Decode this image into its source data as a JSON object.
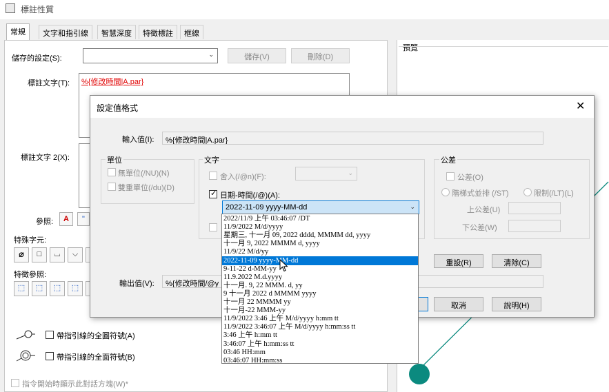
{
  "window": {
    "title": "標註性質"
  },
  "tabs": [
    "常規",
    "文字和指引線",
    "智慧深度",
    "特徵標註",
    "框線"
  ],
  "main": {
    "saved_label": "儲存的設定(S):",
    "save_btn": "儲存(V)",
    "delete_btn": "刪除(D)",
    "note_text_label": "標註文字(T):",
    "note_text_value": "%{修改時間|A.par}",
    "note_text2_label": "標註文字 2(X):",
    "ref_label": "參照:",
    "special_chars_label": "特殊字元:",
    "feature_ref_label": "特徵參照:",
    "leader_full_circle": "帶指引線的全圓符號(A)",
    "leader_full_surface": "帶指引線的全面符號(B)",
    "show_dialog_on_start": "指令開始時顯示此對話方塊(W)*",
    "preview_label": "預覽"
  },
  "dialog": {
    "title": "設定值格式",
    "input_label": "輸入值(I):",
    "input_value": "%{修改時間|A.par}",
    "unit_group": "單位",
    "no_unit": "無單位(/NU)(N)",
    "dual_unit": "雙重單位(/du)(D)",
    "text_group": "文字",
    "round_label": "舍入(/@n)(F):",
    "datetime_label": "日期-時間(/@)(A):",
    "datetime_selected": "2022-11-09     yyyy-MM-dd",
    "tolerance_group": "公差",
    "tolerance_chk": "公差(O)",
    "stepped": "階梯式並排 (/ST)",
    "limit": "限制(/LT)(L)",
    "upper_tol": "上公差(U)",
    "lower_tol": "下公差(W)",
    "reset_btn": "重設(R)",
    "clear_btn": "清除(C)",
    "output_label": "輸出值(V):",
    "output_value": "%{修改時間/@y",
    "cancel_btn": "取消",
    "help_btn": "說明(H)",
    "close_glyph": "✕"
  },
  "dropdown_items": [
    "2022/11/9 上午 03:46:07     /DT",
    "11/9/2022     M/d/yyyy",
    "星期三, 十一月 09, 2022     dddd, MMMM dd, yyyy",
    "十一月 9, 2022     MMMM d, yyyy",
    "11/9/22     M/d/yy",
    "2022-11-09     yyyy-MM-dd",
    "9-11-22     d-MM-yy",
    "11.9.2022     M.d.yyyy",
    "十一月. 9, 22     MMM. d, yy",
    "9 十一月 2022     d MMMM yyyy",
    "十一月 22     MMMM yy",
    "十一月-22     MMM-yy",
    "11/9/2022 3:46 上午     M/d/yyyy h:mm tt",
    "11/9/2022 3:46:07 上午     M/d/yyyy h:mm:ss tt",
    "3:46 上午     h:mm tt",
    "3:46:07 上午     h:mm:ss tt",
    "03:46     HH:mm",
    "03:46:07     HH:mm:ss"
  ],
  "dropdown_selected_index": 5,
  "colors": {
    "accent": "#0078d7",
    "link_red": "#e00000",
    "preview_teal": "#0b8a7f"
  }
}
